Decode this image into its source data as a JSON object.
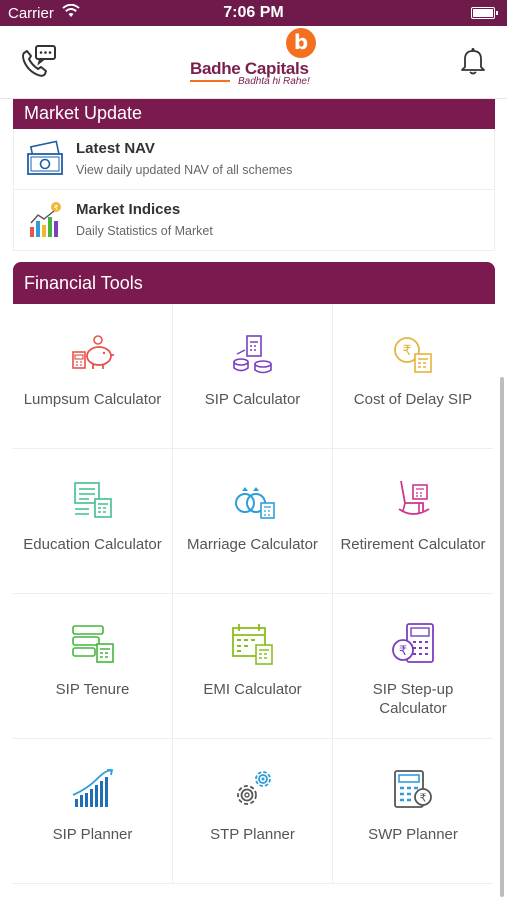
{
  "status_bar": {
    "carrier": "Carrier",
    "time": "7:06 PM"
  },
  "header": {
    "brand": "Badhe Capitals",
    "logo_letter": "b",
    "tagline": "Badhta hi Rahe!"
  },
  "market_update": {
    "title": "Market Update",
    "items": [
      {
        "title": "Latest NAV",
        "subtitle": "View daily updated NAV of all schemes",
        "icon": "money-icon"
      },
      {
        "title": "Market Indices",
        "subtitle": "Daily Statistics of Market",
        "icon": "bar-chart-icon"
      }
    ]
  },
  "financial_tools": {
    "title": "Financial Tools",
    "tools": [
      {
        "label": "Lumpsum Calculator",
        "icon": "piggy-bank-icon",
        "color": "#e9534b"
      },
      {
        "label": "SIP Calculator",
        "icon": "coins-calculator-icon",
        "color": "#7b3fbf"
      },
      {
        "label": "Cost of Delay SIP",
        "icon": "rupee-calculator-icon",
        "color": "#e4b43b"
      },
      {
        "label": "Education Calculator",
        "icon": "education-icon",
        "color": "#3fbf8c"
      },
      {
        "label": "Marriage Calculator",
        "icon": "rings-icon",
        "color": "#2f9ed8"
      },
      {
        "label": "Retirement Calculator",
        "icon": "rocking-chair-icon",
        "color": "#d0338f"
      },
      {
        "label": "SIP Tenure",
        "icon": "tenure-icon",
        "color": "#45b53d"
      },
      {
        "label": "EMI Calculator",
        "icon": "calendar-calculator-icon",
        "color": "#8bbd1f"
      },
      {
        "label": "SIP Step-up Calculator",
        "icon": "stepup-icon",
        "color": "#7a3fbf"
      },
      {
        "label": "SIP Planner",
        "icon": "growth-chart-icon",
        "color": "#1f6fb5"
      },
      {
        "label": "STP Planner",
        "icon": "gears-icon",
        "color": "#555555"
      },
      {
        "label": "SWP Planner",
        "icon": "swp-calculator-icon",
        "color": "#1f6fb5"
      }
    ]
  },
  "colors": {
    "accent": "#7a1a4f",
    "brand_orange": "#f37021"
  }
}
